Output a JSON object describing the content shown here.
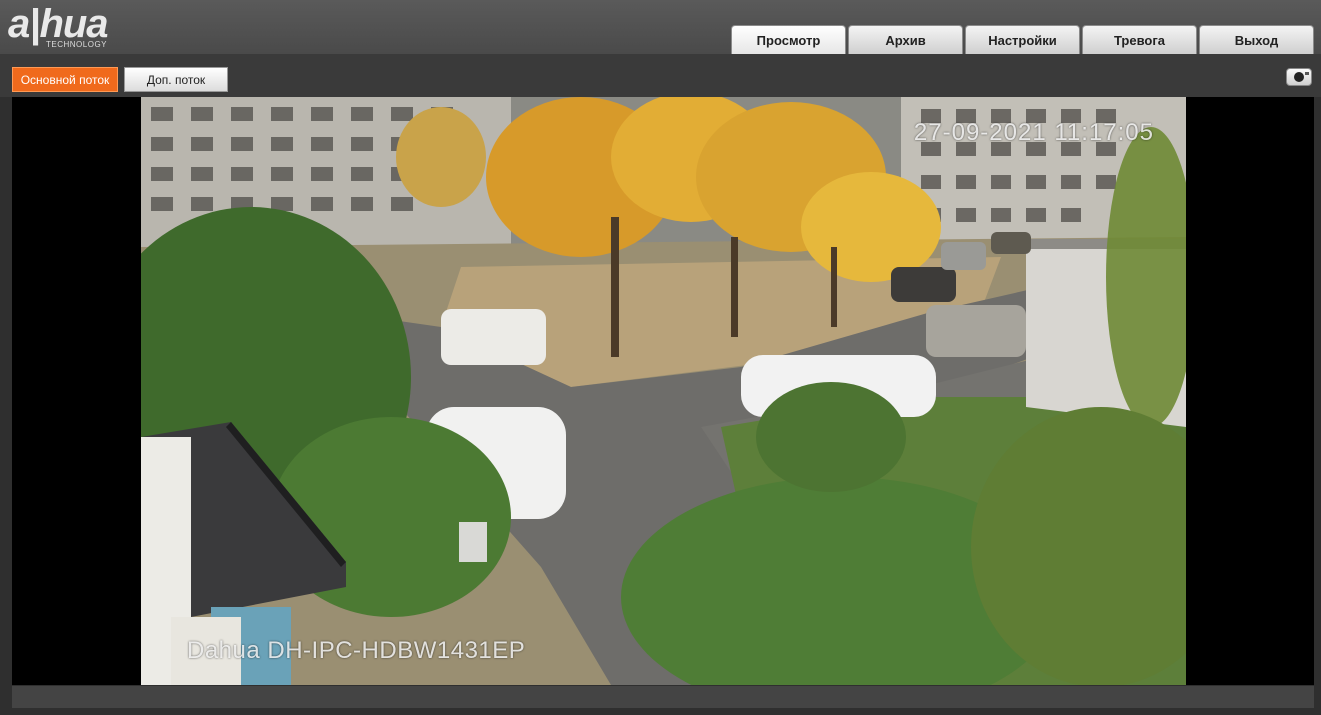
{
  "brand": {
    "logo_text": "a|hua",
    "logo_subtext": "TECHNOLOGY"
  },
  "nav": {
    "tabs": [
      {
        "label": "Просмотр",
        "active": true
      },
      {
        "label": "Архив",
        "active": false
      },
      {
        "label": "Настройки",
        "active": false
      },
      {
        "label": "Тревога",
        "active": false
      },
      {
        "label": "Выход",
        "active": false
      }
    ]
  },
  "stream": {
    "main_label": "Основной поток",
    "sub_label": "Доп. поток",
    "selected": "main"
  },
  "toolbar": {
    "snapshot_icon": "camera-icon"
  },
  "video": {
    "timestamp": "27-09-2021 11:17:05",
    "camera_name": "Dahua DH-IPC-HDBW1431EP"
  },
  "colors": {
    "accent": "#f06a1c",
    "header_bg": "#555555",
    "page_bg": "#2f2f2f"
  }
}
